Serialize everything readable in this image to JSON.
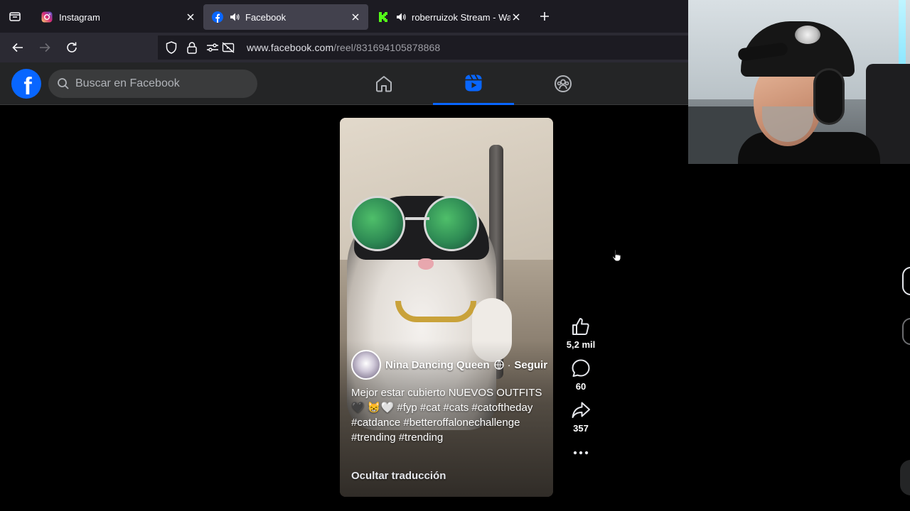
{
  "browser": {
    "tabs": [
      {
        "label": "Instagram",
        "icon": "instagram-icon",
        "active": false,
        "audio": false
      },
      {
        "label": "Facebook",
        "icon": "facebook-icon",
        "active": true,
        "audio": true
      },
      {
        "label": "roberruizok Stream - Watch",
        "icon": "kick-icon",
        "active": false,
        "audio": true
      }
    ],
    "url": {
      "host": "www.facebook.com",
      "path": "/reel/831694105878868"
    }
  },
  "facebook": {
    "logo": "f",
    "search_placeholder": "Buscar en Facebook",
    "nav": [
      {
        "name": "home",
        "active": false
      },
      {
        "name": "reels",
        "active": true
      },
      {
        "name": "groups",
        "active": false
      }
    ],
    "accent": "#0866ff"
  },
  "reel": {
    "author": "Nina Dancing Queen",
    "separator": "·",
    "follow": "Seguir",
    "caption": {
      "text": "Mejor estar cubierto NUEVOS OUTFITS",
      "emojis": "🖤 😸🤍",
      "hashtags": "#fyp #cat #cats #catoftheday #catdance #betteroffalonechallenge #trending #trending"
    },
    "hide_translation": "Ocultar traducción"
  },
  "actions": {
    "likes": "5,2 mil",
    "comments": "60",
    "shares": "357"
  }
}
